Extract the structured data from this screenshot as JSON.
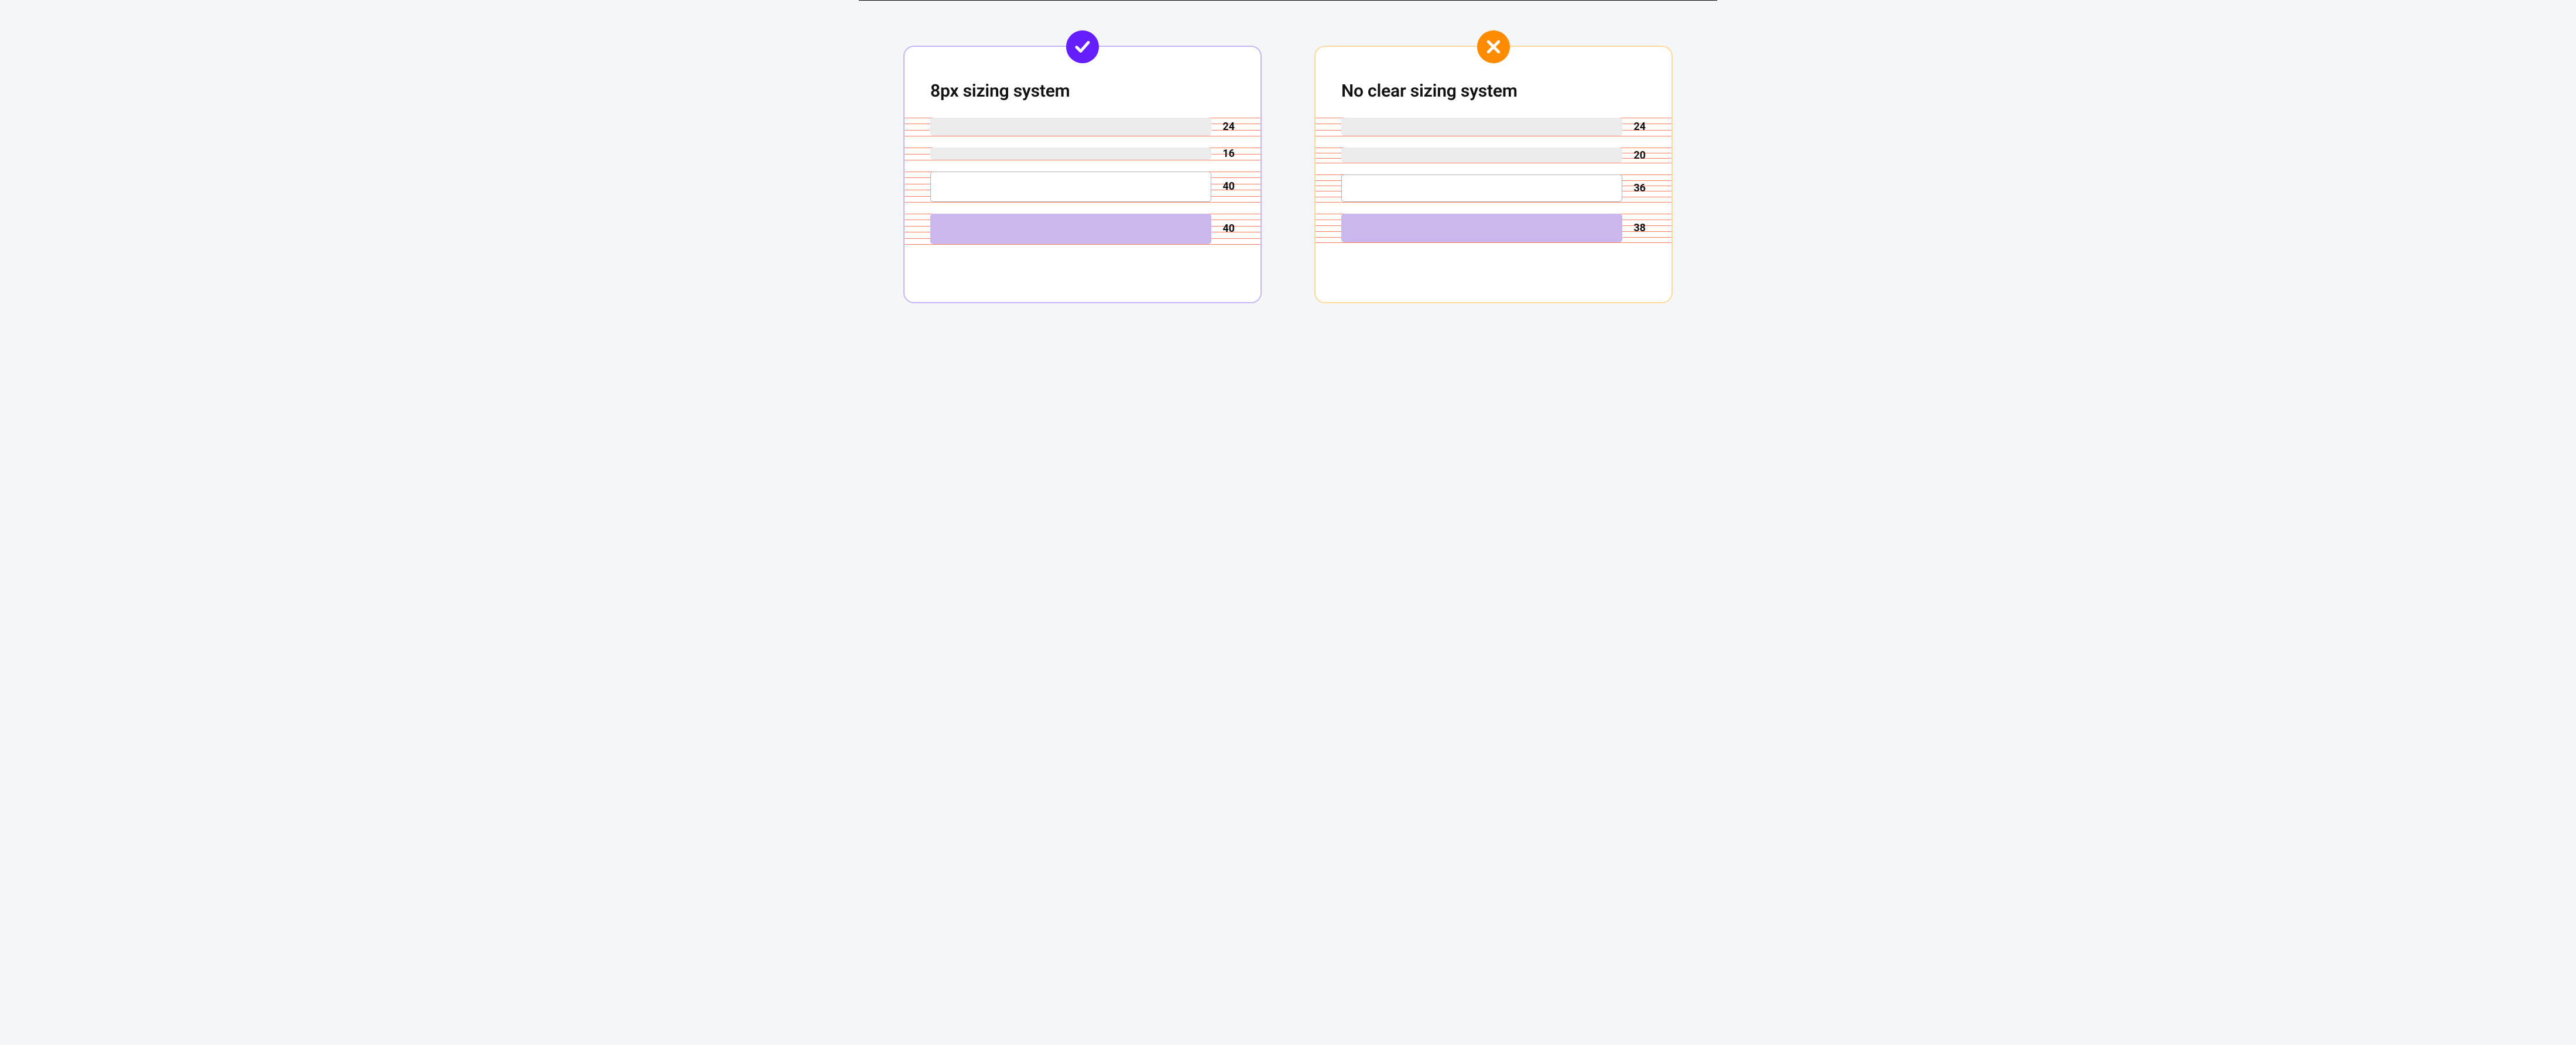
{
  "panels": [
    {
      "kind": "good",
      "title": "8px sizing system",
      "rows": [
        {
          "style": "gray",
          "label": "24",
          "h": 24
        },
        {
          "style": "gray",
          "label": "16",
          "h": 16
        },
        {
          "style": "outline",
          "label": "40",
          "h": 40
        },
        {
          "style": "purple",
          "label": "40",
          "h": 40
        }
      ]
    },
    {
      "kind": "bad",
      "title": "No clear sizing system",
      "rows": [
        {
          "style": "gray",
          "label": "24",
          "h": 24
        },
        {
          "style": "gray",
          "label": "20",
          "h": 20
        },
        {
          "style": "outline",
          "label": "36",
          "h": 36
        },
        {
          "style": "purple",
          "label": "38",
          "h": 38
        }
      ]
    }
  ],
  "colors": {
    "good_border": "#c3b5ff",
    "bad_border": "#ffd999",
    "good_badge": "#651fff",
    "bad_badge": "#ff8b00",
    "grid_line": "#ff6a4a",
    "row_gray": "#ececec",
    "row_purple": "#c9b7ee"
  }
}
